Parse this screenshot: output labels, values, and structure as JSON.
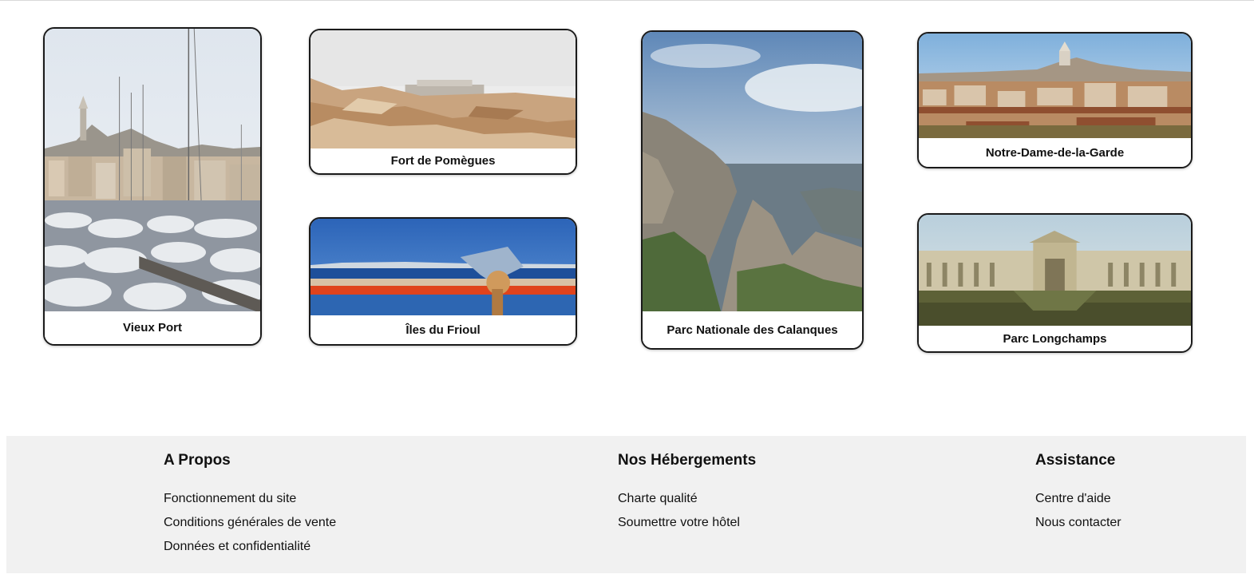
{
  "gallery": {
    "cards": [
      {
        "label": "Vieux Port"
      },
      {
        "label": "Fort de Pomègues"
      },
      {
        "label": "Îles du Frioul"
      },
      {
        "label": "Parc Nationale des Calanques"
      },
      {
        "label": "Notre-Dame-de-la-Garde"
      },
      {
        "label": "Parc Longchamps"
      }
    ]
  },
  "footer": {
    "about": {
      "title": "A Propos",
      "links": [
        "Fonctionnement du site",
        "Conditions générales de vente",
        "Données et confidentialité"
      ]
    },
    "hosting": {
      "title": "Nos Hébergements",
      "links": [
        "Charte qualité",
        "Soumettre votre hôtel"
      ]
    },
    "help": {
      "title": "Assistance",
      "links": [
        "Centre d'aide",
        "Nous contacter"
      ]
    }
  },
  "colors": {
    "footer_bg": "#f1f1f1",
    "card_border": "#1a1a1a",
    "text": "#111111"
  }
}
